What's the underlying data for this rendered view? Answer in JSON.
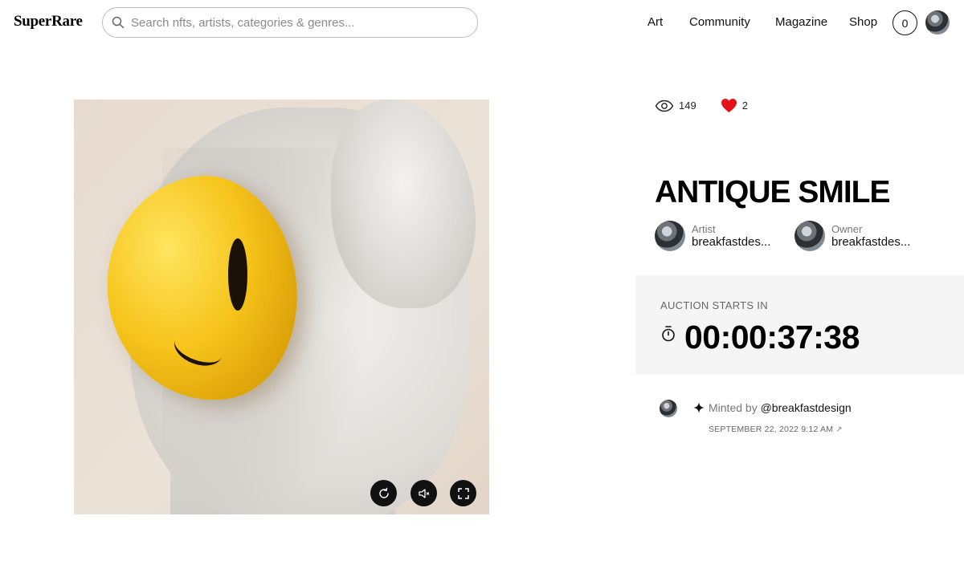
{
  "header": {
    "logo": "SuperRare",
    "search_placeholder": "Search nfts, artists, categories & genres...",
    "nav": [
      "Art",
      "Community",
      "Magazine",
      "Shop"
    ],
    "notification_count": "0"
  },
  "artwork": {
    "controls": [
      "replay",
      "mute",
      "fullscreen"
    ]
  },
  "details": {
    "views": "149",
    "likes": "2",
    "title": "ANTIQUE SMILE",
    "artist_label": "Artist",
    "artist_name": "breakfastdes...",
    "owner_label": "Owner",
    "owner_name": "breakfastdes..."
  },
  "auction": {
    "label": "AUCTION STARTS IN",
    "countdown": "00:00:37:38"
  },
  "history": {
    "prefix": "Minted by ",
    "user": "@breakfastdesign",
    "date": "SEPTEMBER 22, 2022 9:12 AM",
    "link_icon": "↗"
  },
  "colors": {
    "like_heart": "#e3121b",
    "auction_bg": "#f5f5f5",
    "smiley_yellow": "#f6c41b"
  }
}
